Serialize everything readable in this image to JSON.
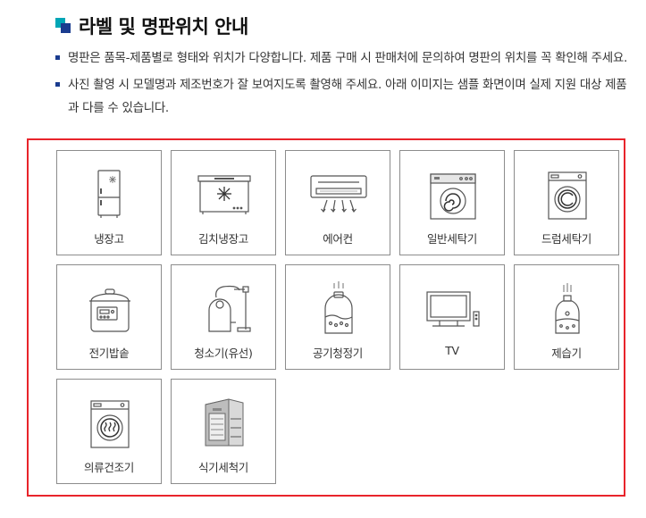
{
  "title": "라벨 및 명판위치 안내",
  "notes": [
    "명판은 품목-제품별로 형태와 위치가 다양합니다. 제품 구매 시 판매처에 문의하여 명판의 위치를 꼭 확인해 주세요.",
    "사진 촬영 시 모델명과 제조번호가 잘 보여지도록 촬영해 주세요. 아래 이미지는 샘플 화면이며 실제 지원 대상 제품과 다를 수 있습니다."
  ],
  "products": [
    {
      "label": "냉장고",
      "icon": "refrigerator-icon"
    },
    {
      "label": "김치냉장고",
      "icon": "kimchi-refrigerator-icon"
    },
    {
      "label": "에어컨",
      "icon": "air-conditioner-icon"
    },
    {
      "label": "일반세탁기",
      "icon": "washing-machine-icon"
    },
    {
      "label": "드럼세탁기",
      "icon": "drum-washer-icon"
    },
    {
      "label": "전기밥솥",
      "icon": "rice-cooker-icon"
    },
    {
      "label": "청소기(유선)",
      "icon": "vacuum-cleaner-icon"
    },
    {
      "label": "공기청정기",
      "icon": "air-purifier-icon"
    },
    {
      "label": "TV",
      "icon": "tv-icon"
    },
    {
      "label": "제습기",
      "icon": "dehumidifier-icon"
    },
    {
      "label": "의류건조기",
      "icon": "clothes-dryer-icon"
    },
    {
      "label": "식기세척기",
      "icon": "dishwasher-icon"
    }
  ],
  "colors": {
    "accent_teal": "#00a6b6",
    "accent_navy": "#1a3c8f",
    "highlight_border": "#e8242b"
  }
}
